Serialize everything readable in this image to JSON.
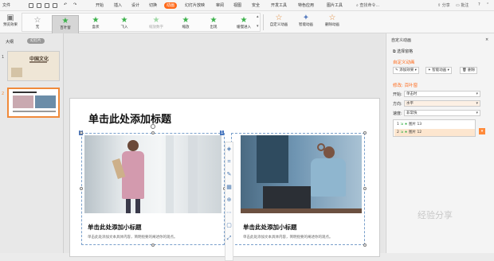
{
  "menubar": {
    "file": "文件",
    "items": [
      "开始",
      "插入",
      "设计",
      "切换",
      "动画",
      "幻灯片放映",
      "审阅",
      "视图",
      "安全",
      "开发工具",
      "特色应用",
      "图片工具"
    ],
    "active": "动画",
    "search": "查找命令...",
    "share": "分享",
    "comment": "批注"
  },
  "ribbon": {
    "preview": "预览效果",
    "effects": [
      {
        "label": "无",
        "icon": "☆"
      },
      {
        "label": "百叶窗",
        "icon": "★"
      },
      {
        "label": "盒状",
        "icon": "★"
      },
      {
        "label": "飞入",
        "icon": "★"
      },
      {
        "label": "缩放数字",
        "icon": "★"
      },
      {
        "label": "缩放",
        "icon": "★"
      },
      {
        "label": "出现",
        "icon": "★"
      },
      {
        "label": "缓慢进入",
        "icon": "★"
      }
    ],
    "custom": "自定义动画",
    "smart": "智能动画",
    "delete": "删除动画"
  },
  "left": {
    "outline": "大纲",
    "slides_tab": "幻灯片",
    "slide_numbers": [
      "1",
      "2"
    ],
    "thumb_title": "中国文化"
  },
  "slide": {
    "title": "单击此处添加标题",
    "col1": {
      "subtitle": "单击此处添加小标题",
      "body": "单击此处添加文本具体内容，简明扼要的阐述你的观点。"
    },
    "col2": {
      "subtitle": "单击此处添加小标题",
      "body": "单击此处添加文本具体内容，简明扼要的阐述你的观点。"
    },
    "badge1": "2",
    "badge2": "1"
  },
  "panel": {
    "title": "自定义动画",
    "select_pane": "选择窗格",
    "section": "自定义动画",
    "add_effect": "添加效果",
    "smart": "智能动画",
    "delete": "删除",
    "modify": "修改: 百叶窗",
    "start_label": "开始:",
    "start_val": "单击时",
    "dir_label": "方向:",
    "dir_val": "水平",
    "speed_label": "速度:",
    "speed_val": "非常快",
    "items": [
      {
        "num": "1",
        "label": "图片 13"
      },
      {
        "num": "2",
        "label": "图片 12"
      }
    ]
  },
  "watermark": "经验分享",
  "colors": {
    "accent": "#ff6a1a",
    "selection": "#f08a3a"
  }
}
